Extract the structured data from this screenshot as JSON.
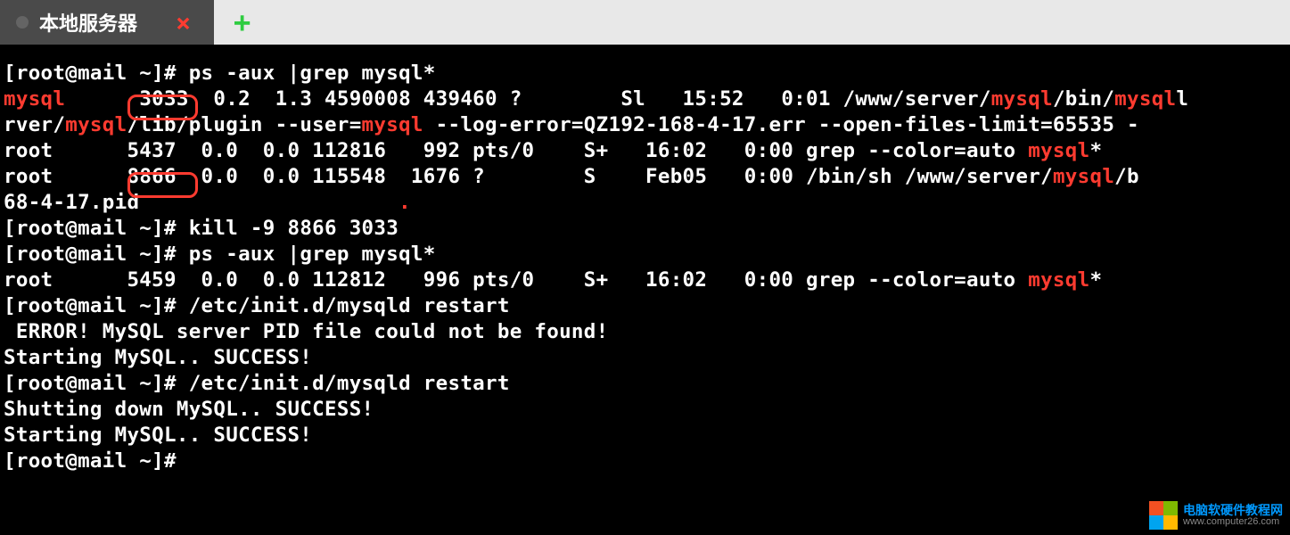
{
  "tab": {
    "title": "本地服务器"
  },
  "watermark": {
    "line1": "电脑软硬件教程网",
    "line2": "www.computer26.com"
  },
  "t": {
    "prompt": "[root@mail ~]#",
    "cmd1": " ps -aux |grep mysql*",
    "user_mysql": "mysql",
    "pid1": "3033",
    "ps1_mid": "  0.2  1.3 4590008 439460 ?        Sl   15:52   0:01 /www/server/",
    "ps1_seg1": "/bin/",
    "ps1_tail": "l",
    "line2_pre": "rver/",
    "line2_mid": "/lib/plugin --user=",
    "line2_tail": " --log-error=QZ192-168-4-17.err --open-files-limit=65535 -",
    "line3_a": "root      5437  0.0  0.0 112816   992 pts/0    S+   16:02   0:00 grep --color=auto ",
    "line3_star": "*",
    "line4_pre": "root      ",
    "pid2": "8866",
    "line4_mid": "  0.0  0.0 115548  1676 ?        S    Feb05   0:00 /bin/sh /www/server/",
    "line4_tail": "/b",
    "line5": "68-4-17.pid",
    "dot": ".",
    "cmd2": " kill -9 8866 3033",
    "cmd3": " ps -aux |grep mysql*",
    "line8_a": "root      5459  0.0  0.0 112812   996 pts/0    S+   16:02   0:00 grep --color=auto ",
    "line8_star": "*",
    "cmd4": " /etc/init.d/mysqld restart",
    "err": " ERROR! MySQL server PID file could not be found!",
    "start": "Starting MySQL.. SUCCESS!",
    "cmd5": " /etc/init.d/mysqld restart",
    "shut": "Shutting down MySQL.. SUCCESS!",
    "start2": "Starting MySQL.. SUCCESS!",
    "mysql": "mysql"
  }
}
